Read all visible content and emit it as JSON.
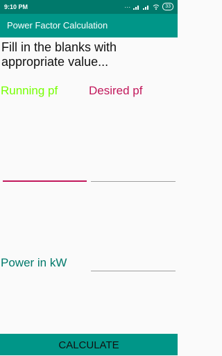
{
  "status_bar": {
    "time": "9:10 PM",
    "battery": "33"
  },
  "app_bar": {
    "title": "Power Factor Calculation"
  },
  "instructions": "Fill in the blanks with appropriate value...",
  "fields": {
    "running_pf": {
      "label": "Running pf"
    },
    "desired_pf": {
      "label": "Desired pf"
    },
    "power": {
      "label": "Power in kW"
    }
  },
  "button": {
    "label": "CALCULATE"
  },
  "colors": {
    "primary": "#009688",
    "primary_dark": "#00796b",
    "running_label": "#76ff03",
    "desired_label": "#c2185b",
    "focused_underline": "#c2185b"
  }
}
